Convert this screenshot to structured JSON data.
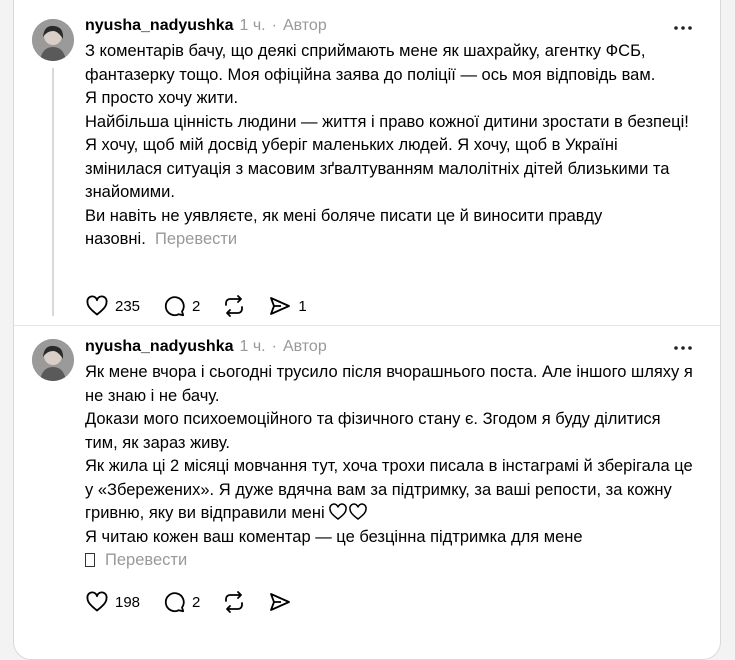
{
  "posts": [
    {
      "username": "nyusha_nadyushka",
      "time": "1 ч.",
      "separator": "·",
      "author_badge": "Автор",
      "paragraphs": [
        "З коментарів бачу, що деякі сприймають мене як шахрайку, агентку ФСБ, фантазерку тощо. Моя офіційна заява до поліції — ось моя відповідь вам.",
        "Я просто хочу жити.",
        "Найбільша цінність людини — життя і право кожної дитини зростати в безпеці!",
        "Я хочу, щоб мій досвід уберіг маленьких людей. Я хочу, щоб в Україні змінилася ситуація з масовим зґвалтуванням малолітніх дітей близькими та знайомими.",
        "Ви навіть не уявляєте, як мені боляче писати це й виносити правду назовні."
      ],
      "translate_label": "Перевести",
      "likes": "235",
      "comments": "2",
      "shares": "1"
    },
    {
      "username": "nyusha_nadyushka",
      "time": "1 ч.",
      "separator": "·",
      "author_badge": "Автор",
      "paragraphs": [
        "Як мене вчора і сьогодні трусило після вчорашнього поста. Але іншого шляху я не знаю і не бачу.",
        "Докази мого психоемоційного та фізичного стану є. Згодом я буду ділитися тим, як зараз живу.",
        "Як жила ці 2 місяці мовчання тут, хоча трохи писала в інстаграмі й зберігала це у «Збережених». Я дуже вдячна вам за підтримку, за ваші репости, за кожну гривню, яку ви відправили мені",
        "Я читаю кожен ваш коментар — це безцінна підтримка для мене"
      ],
      "translate_label": "Перевести",
      "likes": "198",
      "comments": "2"
    }
  ],
  "icons": {
    "more": "more-horizontal-icon",
    "like": "heart-icon",
    "comment": "comment-bubble-icon",
    "repost": "repost-icon",
    "share": "send-icon"
  }
}
